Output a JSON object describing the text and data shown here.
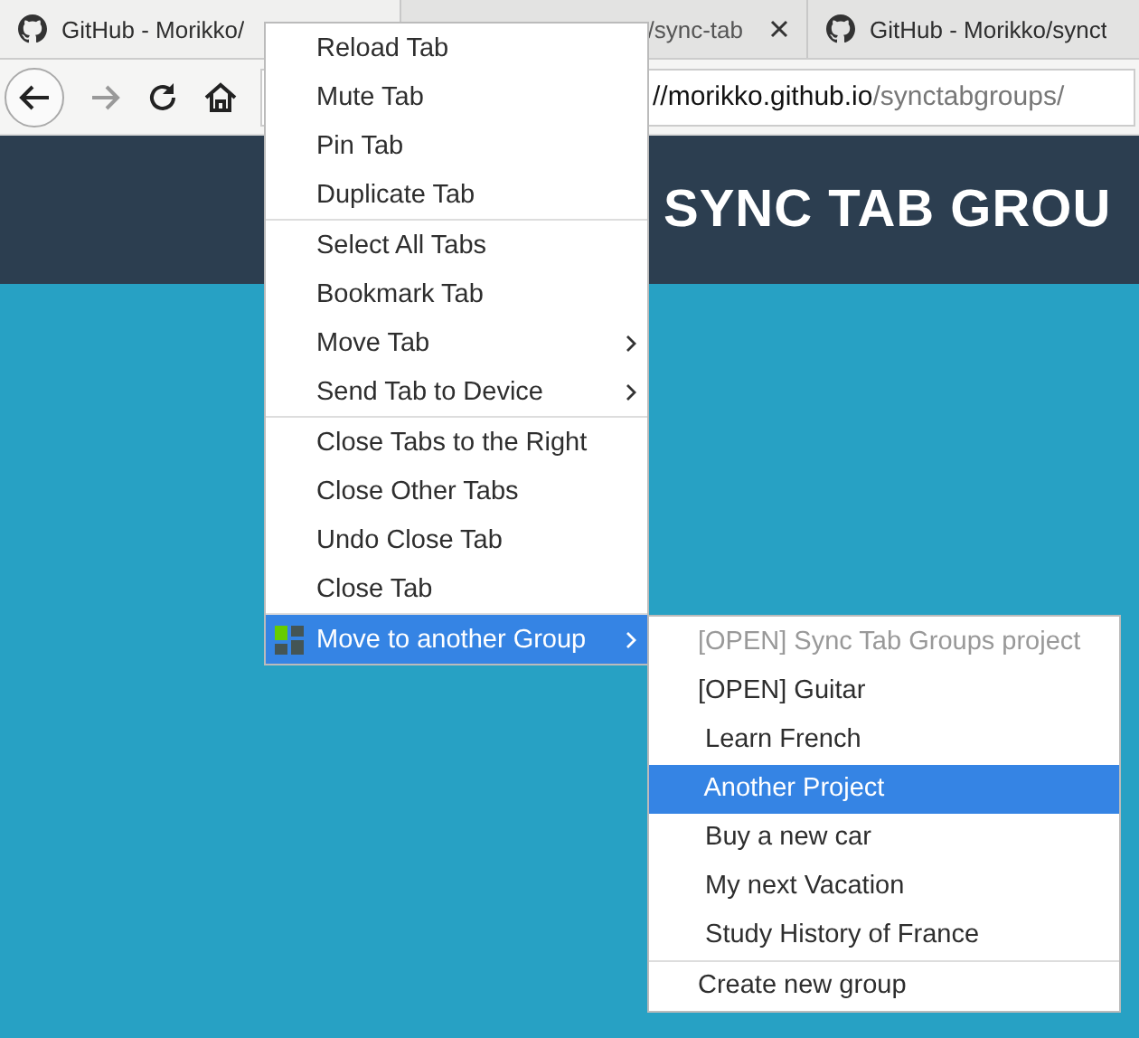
{
  "tabs": [
    {
      "title": "GitHub - Morikko/",
      "selected": true,
      "closable": false
    },
    {
      "title": "/sync-tab",
      "selected": false,
      "closable": true
    },
    {
      "title": "GitHub - Morikko/synct",
      "selected": false,
      "closable": false
    }
  ],
  "address_bar": {
    "host": "//morikko.github.io",
    "path": "/synctabgroups/"
  },
  "page_header": {
    "title": "SYNC TAB GROU"
  },
  "context_menu": {
    "sections": [
      [
        {
          "label": "Reload Tab",
          "submenu": false,
          "selected": false
        },
        {
          "label": "Mute Tab",
          "submenu": false,
          "selected": false
        },
        {
          "label": "Pin Tab",
          "submenu": false,
          "selected": false
        },
        {
          "label": "Duplicate Tab",
          "submenu": false,
          "selected": false
        }
      ],
      [
        {
          "label": "Select All Tabs",
          "submenu": false,
          "selected": false
        },
        {
          "label": "Bookmark Tab",
          "submenu": false,
          "selected": false
        },
        {
          "label": "Move Tab",
          "submenu": true,
          "selected": false
        },
        {
          "label": "Send Tab to Device",
          "submenu": true,
          "selected": false
        }
      ],
      [
        {
          "label": "Close Tabs to the Right",
          "submenu": false,
          "selected": false
        },
        {
          "label": "Close Other Tabs",
          "submenu": false,
          "selected": false
        },
        {
          "label": "Undo Close Tab",
          "submenu": false,
          "selected": false
        },
        {
          "label": "Close Tab",
          "submenu": false,
          "selected": false
        }
      ],
      [
        {
          "label": "Move to another Group",
          "submenu": true,
          "selected": true,
          "icon": true
        }
      ]
    ]
  },
  "group_submenu": {
    "sections": [
      [
        {
          "label": "[OPEN] Sync Tab Groups project",
          "disabled": true,
          "selected": false
        },
        {
          "label": "[OPEN] Guitar",
          "disabled": false,
          "selected": false
        },
        {
          "label": " Learn French",
          "disabled": false,
          "selected": false
        },
        {
          "label": " Another Project",
          "disabled": false,
          "selected": true
        },
        {
          "label": " Buy a new car",
          "disabled": false,
          "selected": false
        },
        {
          "label": " My next Vacation",
          "disabled": false,
          "selected": false
        },
        {
          "label": " Study History of France",
          "disabled": false,
          "selected": false
        }
      ],
      [
        {
          "label": "Create new group",
          "disabled": false,
          "selected": false
        }
      ]
    ]
  }
}
